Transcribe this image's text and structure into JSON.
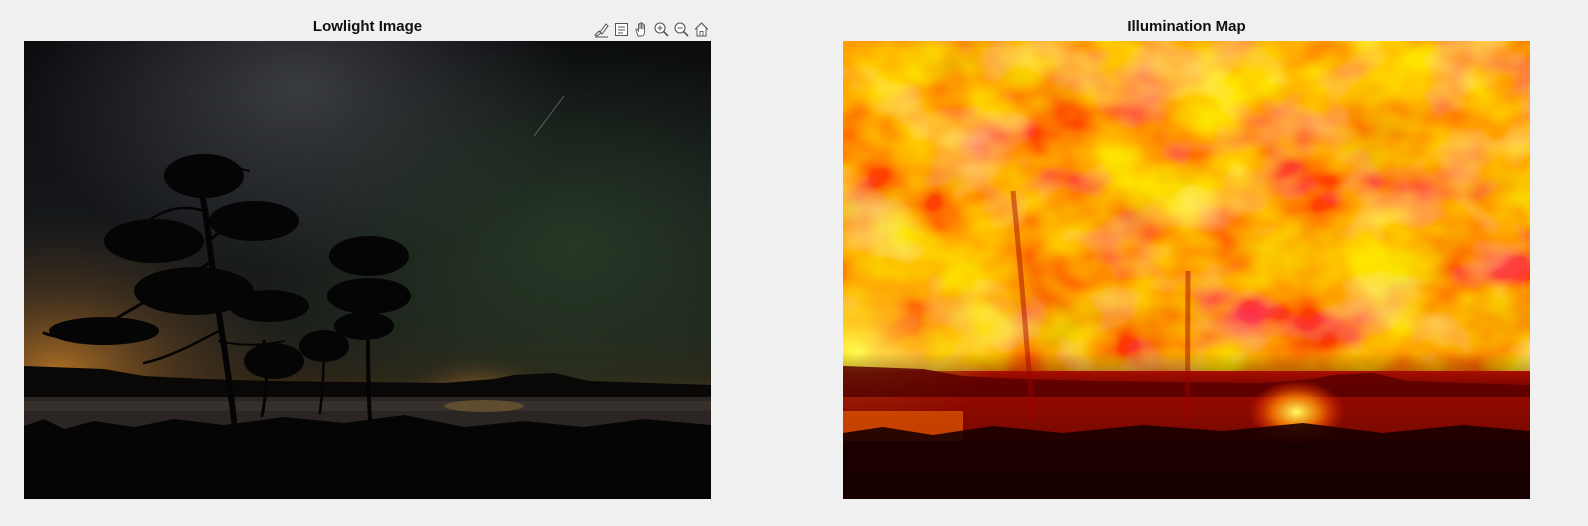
{
  "figure": {
    "left_title": "Lowlight Image",
    "right_title": "Illumination Map"
  },
  "axes_toolbar": {
    "buttons": [
      {
        "name": "brush-data",
        "icon": "brush-icon"
      },
      {
        "name": "data-tips",
        "icon": "datatip-icon"
      },
      {
        "name": "pan",
        "icon": "hand-icon"
      },
      {
        "name": "zoom-in",
        "icon": "zoom-in-icon"
      },
      {
        "name": "zoom-out",
        "icon": "zoom-out-icon"
      },
      {
        "name": "restore-view",
        "icon": "home-icon"
      }
    ]
  },
  "colors": {
    "background": "#f0f0f0",
    "night_sky_top": "#0b0d10",
    "horizon_glow": "#d58a2a",
    "green_airglow": "#2a3a22",
    "heat_red": "#e00000",
    "heat_orange": "#ff7a00",
    "heat_yellow": "#ffff40"
  }
}
